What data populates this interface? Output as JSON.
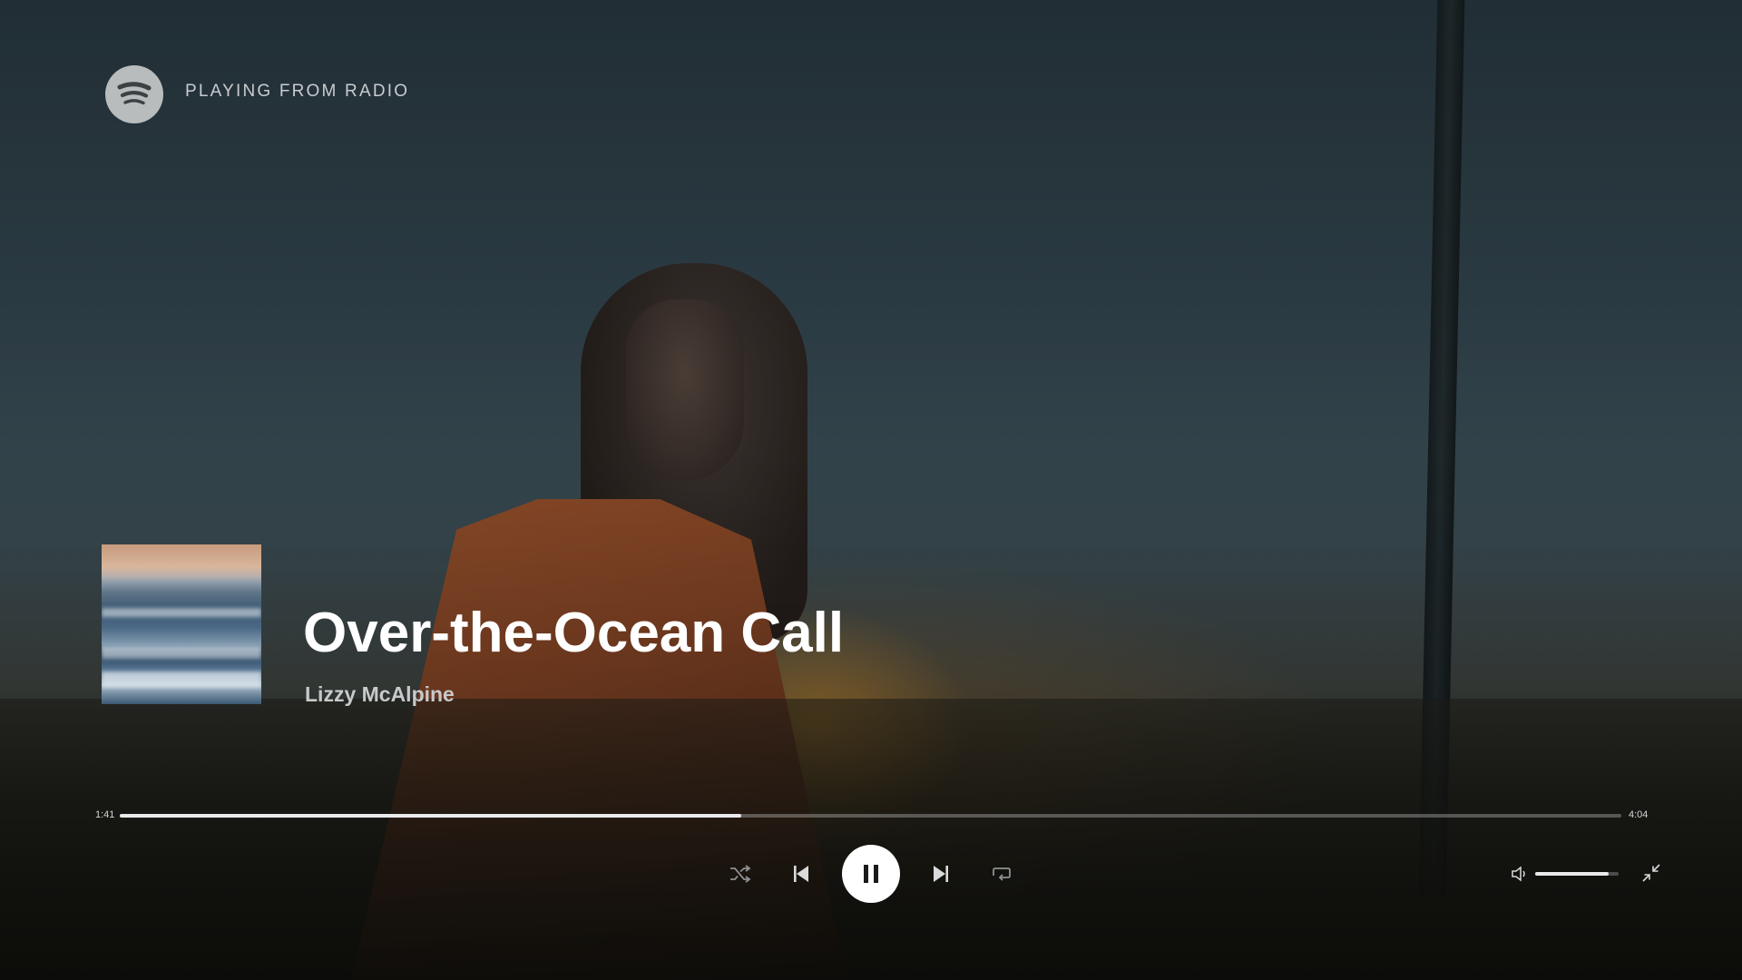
{
  "header": {
    "context_label": "PLAYING FROM RADIO",
    "logo_icon": "spotify-logo-icon"
  },
  "track": {
    "title": "Over-the-Ocean Call",
    "artist": "Lizzy McAlpine"
  },
  "playback": {
    "elapsed": "1:41",
    "total": "4:04",
    "progress_fraction": 0.414,
    "state": "playing"
  },
  "controls": {
    "shuffle_icon": "shuffle-icon",
    "previous_icon": "skip-previous-icon",
    "play_pause_icon": "pause-icon",
    "next_icon": "skip-next-icon",
    "repeat_icon": "repeat-icon"
  },
  "volume": {
    "icon": "speaker-icon",
    "level_fraction": 0.88
  },
  "window": {
    "minimize_icon": "exit-fullscreen-icon"
  },
  "colors": {
    "text_primary": "#ffffff",
    "text_secondary": "#c7c9cb",
    "control_dim": "#8d9193",
    "control_active": "#d9dbdc",
    "play_button_bg": "#ffffff"
  }
}
